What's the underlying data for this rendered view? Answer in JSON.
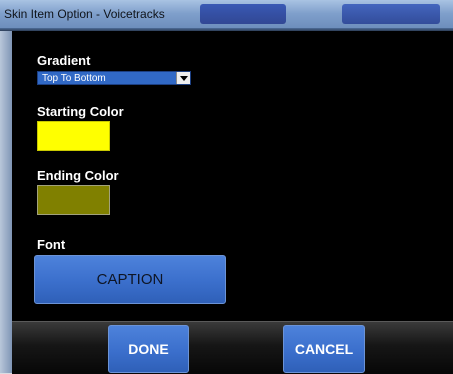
{
  "window": {
    "title": "Skin Item Option - Voicetracks"
  },
  "gradient": {
    "label": "Gradient",
    "selected": "Top To Bottom"
  },
  "starting_color": {
    "label": "Starting Color",
    "value": "#FFFF00"
  },
  "ending_color": {
    "label": "Ending Color",
    "value": "#808000"
  },
  "font": {
    "label": "Font",
    "button_label": "CAPTION"
  },
  "actions": {
    "done_label": "DONE",
    "cancel_label": "CANCEL"
  }
}
